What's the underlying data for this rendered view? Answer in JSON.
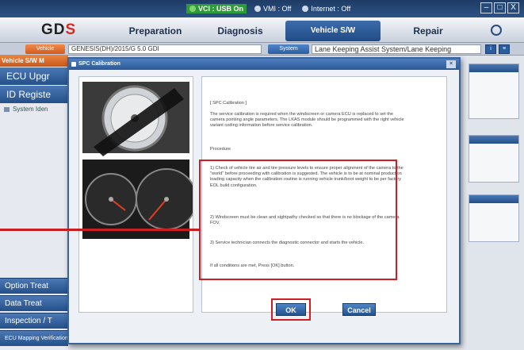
{
  "status": {
    "vci": "VCI : USB On",
    "vmi": "VMI : Off",
    "internet": "Internet : Off"
  },
  "window_controls": {
    "minimize": "–",
    "maximize": "□",
    "close": "X"
  },
  "nav": {
    "logo_left": "GD",
    "logo_right": "S",
    "tabs": [
      {
        "label": "Preparation"
      },
      {
        "label": "Diagnosis"
      },
      {
        "label": "Vehicle S/W Management"
      },
      {
        "label": "Repair"
      }
    ]
  },
  "vehicle_row": {
    "vehicle_button": "Vehicle",
    "vehicle_value": "GENESIS(DH)/2015/G 5.0 GDI",
    "system_button": "System",
    "system_value": "Lane Keeping Assist System/Lane Keeping"
  },
  "sidebar": {
    "header": "Vehicle S/W M",
    "items": [
      {
        "label": "ECU Upgr"
      },
      {
        "label": "ID Registe"
      }
    ],
    "sub_item": "System Iden",
    "bottom_items": [
      {
        "label": "Option Treat"
      },
      {
        "label": "Data Treat"
      },
      {
        "label": "Inspection / T"
      },
      {
        "label": "ECU Mapping Verification"
      }
    ]
  },
  "dialog": {
    "title": "SPC Calibration",
    "heading": "[ SPC Calibration ]",
    "intro": "The service calibration is required when the windscreen or camera ECU is replaced to set the camera pointing angle parameters. The LKAS module should be programmed with the right vehicle variant coding information before service calibration.",
    "procedure_label": "Procedure",
    "steps": [
      "1) Check of vehicle tire air and tire pressure levels to ensure proper alignment of the camera to the \"world\" before proceeding with calibration is suggested. The vehicle is to be at nominal production loading capacity when the calibration routine is running vehicle trunk/boot weight to be per factory EOL build configuration.",
      "2) Windscreen must be clean and sightpathy checked so that there is no blockage of the camera FOV.",
      "3) Service technician connects the diagnostic connector and starts the vehicle."
    ],
    "closing": "If all conditions are met, Press [OK] button.",
    "ok_label": "OK",
    "cancel_label": "Cancel"
  }
}
